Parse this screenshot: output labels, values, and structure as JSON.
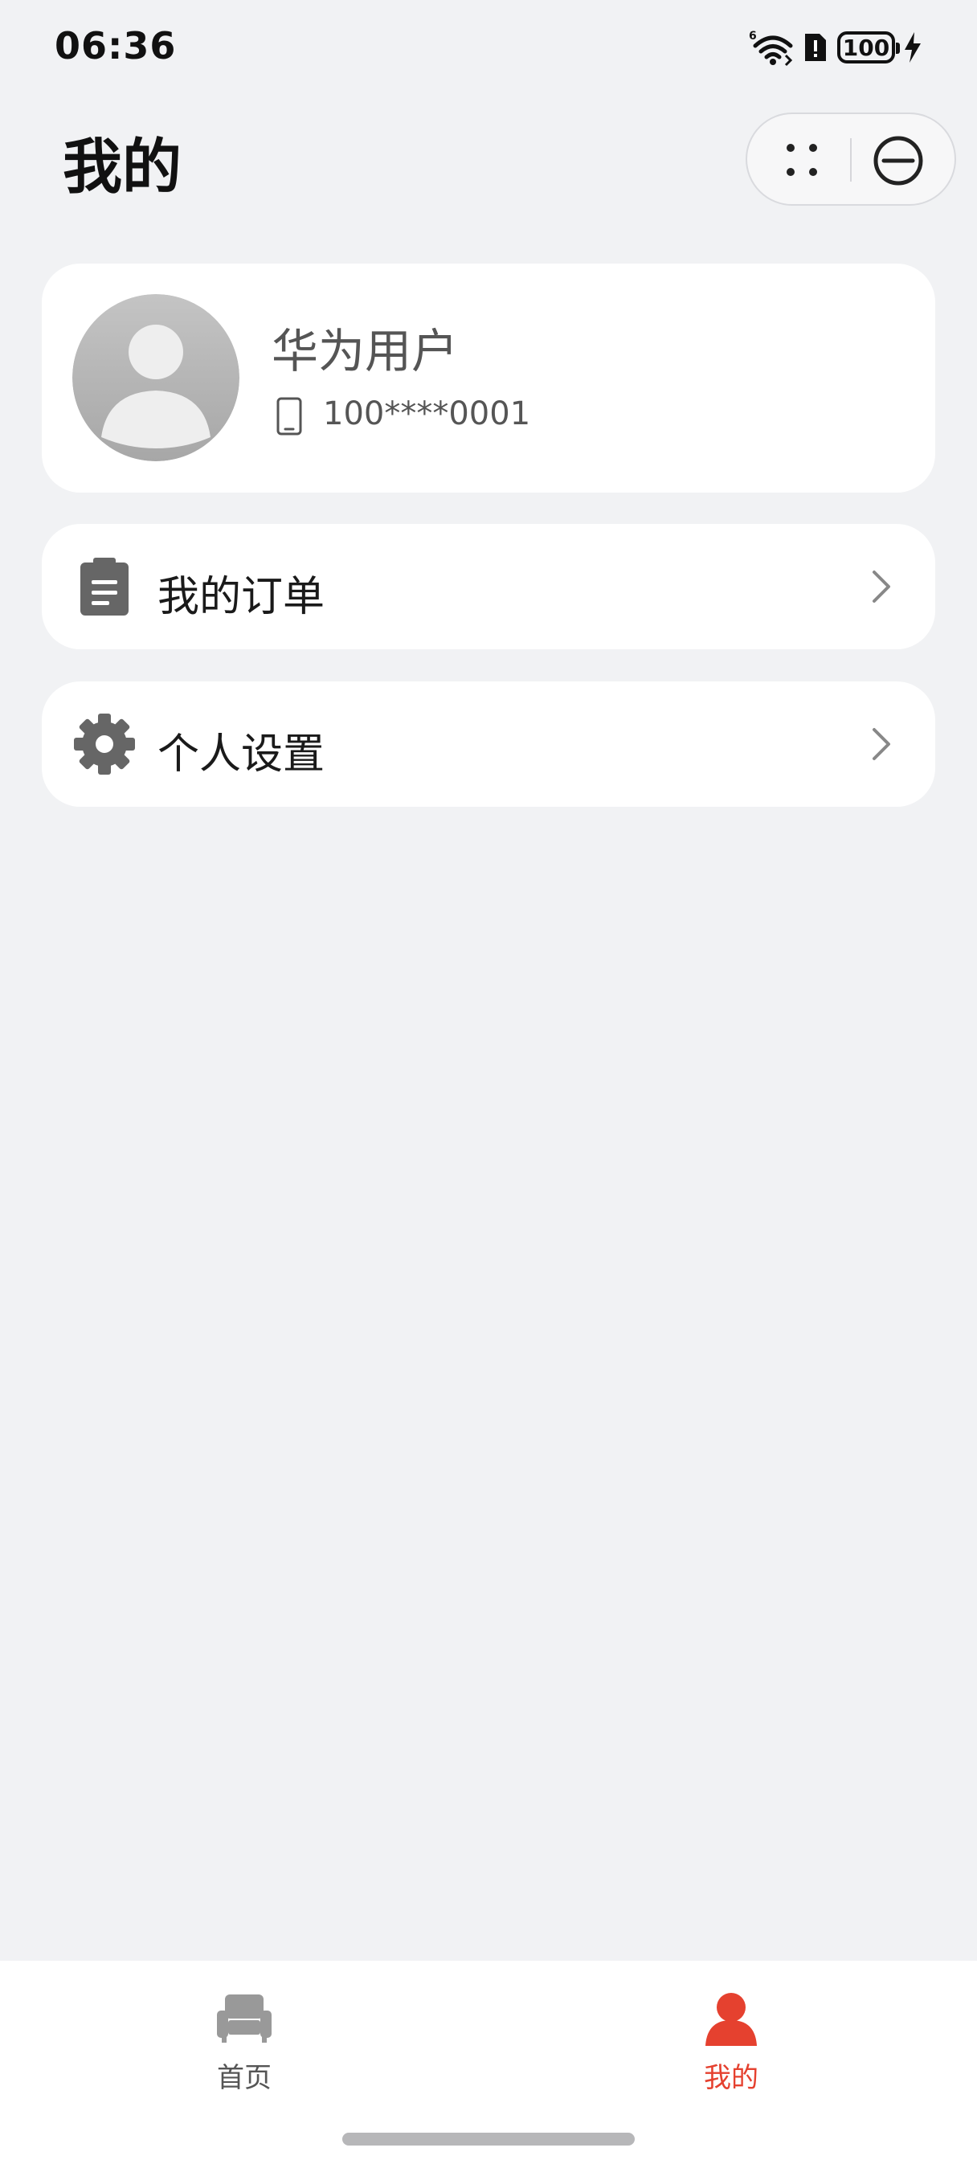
{
  "status_bar": {
    "time": "06:36",
    "battery": "100"
  },
  "header": {
    "title": "我的"
  },
  "profile": {
    "name": "华为用户",
    "phone": "100****0001"
  },
  "menu": [
    {
      "label": "我的订单",
      "icon": "clipboard-icon"
    },
    {
      "label": "个人设置",
      "icon": "gear-icon"
    }
  ],
  "tabs": [
    {
      "label": "首页",
      "icon": "sofa-icon",
      "active": false
    },
    {
      "label": "我的",
      "icon": "person-icon",
      "active": true
    }
  ],
  "colors": {
    "background": "#f1f2f4",
    "card": "#ffffff",
    "accent": "#e5412f",
    "inactive_tab": "#555555",
    "icon_gray": "#666666"
  }
}
